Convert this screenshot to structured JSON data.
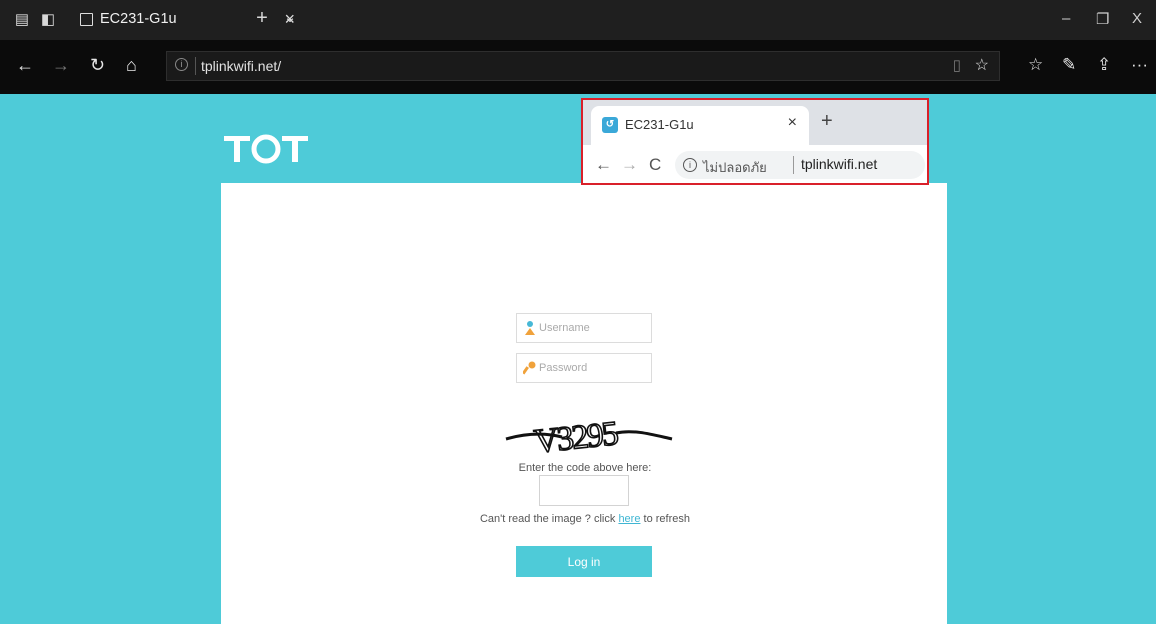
{
  "edge": {
    "tab_title": "EC231-G1u",
    "tab_close": "×",
    "new_tab": "+",
    "tab_list": "⌄",
    "url": "tplinkwifi.net/",
    "window_minimize": "–",
    "window_restore": "❐",
    "window_close": "X",
    "nav_back": "←",
    "nav_forward": "→",
    "nav_refresh": "↻",
    "nav_home": "⌂"
  },
  "chrome_callout": {
    "tab_title": "EC231-G1u",
    "tab_close": "×",
    "new_tab": "+",
    "nav_back": "←",
    "nav_forward": "→",
    "nav_refresh": "C",
    "security_status": "ไม่ปลอดภัย",
    "url": "tplinkwifi.net",
    "border_color": "#d9202a"
  },
  "login": {
    "username_placeholder": "Username",
    "password_placeholder": "Password",
    "captcha_text": "V3295",
    "code_label": "Enter the code above here:",
    "refresh_prefix": "Can't read the image ? click ",
    "refresh_link": "here",
    "refresh_suffix": " to refresh",
    "login_label": "Log in"
  },
  "colors": {
    "page_bg": "#4ecbd8",
    "accent": "#4ecbd8",
    "link": "#3fb6d3"
  }
}
